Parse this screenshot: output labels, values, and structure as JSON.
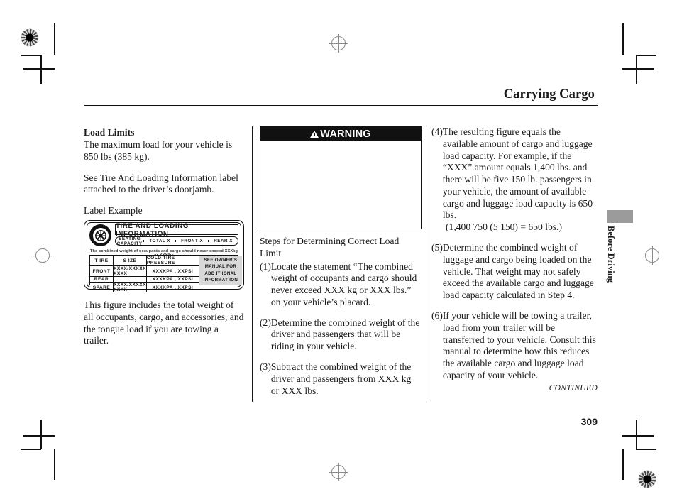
{
  "page": {
    "header_title": "Carrying Cargo",
    "page_number": "309",
    "continued": "CONTINUED",
    "side_tab": "Before Driving"
  },
  "column1": {
    "section_heading": "Load Limits",
    "para1": "The maximum load for your vehicle is 850 lbs (385 kg).",
    "para2": "See Tire And Loading Information label attached to the driver’s doorjamb.",
    "para3": "Label Example",
    "para4": "This figure includes the total weight of all occupants, cargo, and accessories, and the tongue load if you are towing a trailer."
  },
  "tire_label": {
    "title": "TIRE  AND  LOADING  INFORMATION",
    "seating_capacity": "SEATING CAPACITY",
    "total": "TOTAL X",
    "front": "FRONT X",
    "rear": "REAR X",
    "fine_print": "The combined weight of occupants and cargo should never exceed XXXkg or XXXlbs",
    "head_tire": "T IRE",
    "head_size": "S IZE",
    "head_pressure": "COLD TIRE PRESSURE",
    "row_front": "FRONT",
    "row_rear": "REAR",
    "row_spare": "SPARE",
    "size_value": "XXXX/XXXXX  XXXX",
    "pressure_front": "XXXKPA , XXPSI",
    "pressure_rear": "XXXKPA , XXPSI",
    "pressure_spare": "XXXKPA , XXPSI",
    "aside_line1": "SEE OWNER’S",
    "aside_line2": "MANUAL  FOR",
    "aside_line3": "ADD IT IONAL",
    "aside_line4": "INFORMAT ION"
  },
  "column2": {
    "warning_label": "WARNING",
    "warning_body": "",
    "steps_heading": "Steps for Determining Correct Load Limit",
    "steps": [
      {
        "num": "(1)",
        "text": "Locate the statement “The combined weight of occupants and cargo should never exceed XXX kg or XXX lbs.” on your vehicle’s placard."
      },
      {
        "num": "(2)",
        "text": "Determine the combined weight of the driver and passengers that will be riding in your vehicle."
      },
      {
        "num": "(3)",
        "text": "Subtract the combined weight of the driver and passengers from XXX kg or XXX lbs."
      }
    ]
  },
  "column3": {
    "steps": [
      {
        "num": "(4)",
        "text": "The resulting figure equals the available amount of cargo and luggage load capacity. For example, if the “XXX” amount equals 1,400 lbs. and there will be five 150 lb. passengers in your vehicle, the amount of available cargo and luggage load capacity is 650 lbs."
      },
      {
        "num": "(5)",
        "text": "Determine the combined weight of luggage and cargo being loaded on the vehicle. That weight may not safely exceed the available cargo and luggage load capacity calculated in Step 4."
      },
      {
        "num": "(6)",
        "text": "If your vehicle will be towing a trailer, load from your trailer will be transferred to your vehicle. Consult this manual to determine how this reduces the available cargo and luggage load capacity of your vehicle."
      }
    ],
    "formula": "(1,400      750 (5      150) = 650 lbs.)"
  }
}
